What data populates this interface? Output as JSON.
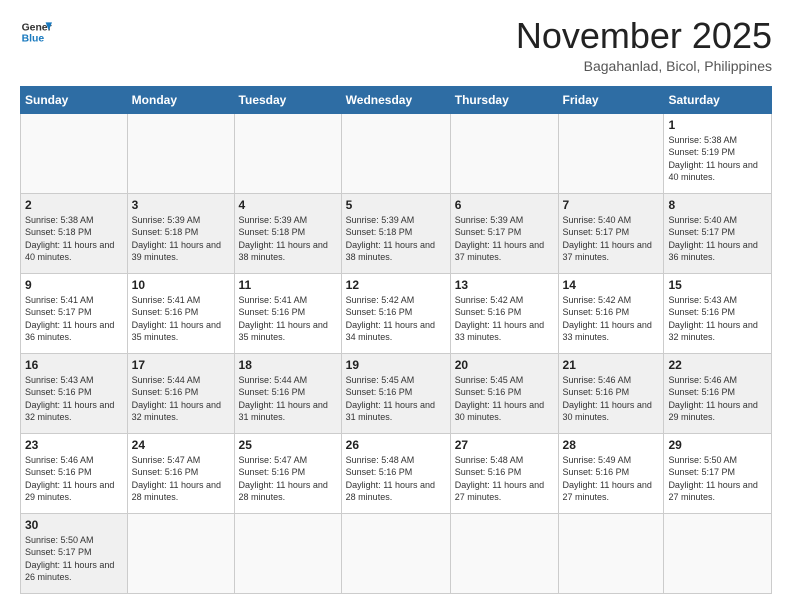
{
  "logo": {
    "line1": "General",
    "line2": "Blue"
  },
  "header": {
    "month": "November 2025",
    "location": "Bagahanlad, Bicol, Philippines"
  },
  "weekdays": [
    "Sunday",
    "Monday",
    "Tuesday",
    "Wednesday",
    "Thursday",
    "Friday",
    "Saturday"
  ],
  "weeks": [
    [
      {
        "day": "",
        "info": ""
      },
      {
        "day": "",
        "info": ""
      },
      {
        "day": "",
        "info": ""
      },
      {
        "day": "",
        "info": ""
      },
      {
        "day": "",
        "info": ""
      },
      {
        "day": "",
        "info": ""
      },
      {
        "day": "1",
        "info": "Sunrise: 5:38 AM\nSunset: 5:19 PM\nDaylight: 11 hours\nand 40 minutes."
      }
    ],
    [
      {
        "day": "2",
        "info": "Sunrise: 5:38 AM\nSunset: 5:18 PM\nDaylight: 11 hours\nand 40 minutes."
      },
      {
        "day": "3",
        "info": "Sunrise: 5:39 AM\nSunset: 5:18 PM\nDaylight: 11 hours\nand 39 minutes."
      },
      {
        "day": "4",
        "info": "Sunrise: 5:39 AM\nSunset: 5:18 PM\nDaylight: 11 hours\nand 38 minutes."
      },
      {
        "day": "5",
        "info": "Sunrise: 5:39 AM\nSunset: 5:18 PM\nDaylight: 11 hours\nand 38 minutes."
      },
      {
        "day": "6",
        "info": "Sunrise: 5:39 AM\nSunset: 5:17 PM\nDaylight: 11 hours\nand 37 minutes."
      },
      {
        "day": "7",
        "info": "Sunrise: 5:40 AM\nSunset: 5:17 PM\nDaylight: 11 hours\nand 37 minutes."
      },
      {
        "day": "8",
        "info": "Sunrise: 5:40 AM\nSunset: 5:17 PM\nDaylight: 11 hours\nand 36 minutes."
      }
    ],
    [
      {
        "day": "9",
        "info": "Sunrise: 5:41 AM\nSunset: 5:17 PM\nDaylight: 11 hours\nand 36 minutes."
      },
      {
        "day": "10",
        "info": "Sunrise: 5:41 AM\nSunset: 5:16 PM\nDaylight: 11 hours\nand 35 minutes."
      },
      {
        "day": "11",
        "info": "Sunrise: 5:41 AM\nSunset: 5:16 PM\nDaylight: 11 hours\nand 35 minutes."
      },
      {
        "day": "12",
        "info": "Sunrise: 5:42 AM\nSunset: 5:16 PM\nDaylight: 11 hours\nand 34 minutes."
      },
      {
        "day": "13",
        "info": "Sunrise: 5:42 AM\nSunset: 5:16 PM\nDaylight: 11 hours\nand 33 minutes."
      },
      {
        "day": "14",
        "info": "Sunrise: 5:42 AM\nSunset: 5:16 PM\nDaylight: 11 hours\nand 33 minutes."
      },
      {
        "day": "15",
        "info": "Sunrise: 5:43 AM\nSunset: 5:16 PM\nDaylight: 11 hours\nand 32 minutes."
      }
    ],
    [
      {
        "day": "16",
        "info": "Sunrise: 5:43 AM\nSunset: 5:16 PM\nDaylight: 11 hours\nand 32 minutes."
      },
      {
        "day": "17",
        "info": "Sunrise: 5:44 AM\nSunset: 5:16 PM\nDaylight: 11 hours\nand 32 minutes."
      },
      {
        "day": "18",
        "info": "Sunrise: 5:44 AM\nSunset: 5:16 PM\nDaylight: 11 hours\nand 31 minutes."
      },
      {
        "day": "19",
        "info": "Sunrise: 5:45 AM\nSunset: 5:16 PM\nDaylight: 11 hours\nand 31 minutes."
      },
      {
        "day": "20",
        "info": "Sunrise: 5:45 AM\nSunset: 5:16 PM\nDaylight: 11 hours\nand 30 minutes."
      },
      {
        "day": "21",
        "info": "Sunrise: 5:46 AM\nSunset: 5:16 PM\nDaylight: 11 hours\nand 30 minutes."
      },
      {
        "day": "22",
        "info": "Sunrise: 5:46 AM\nSunset: 5:16 PM\nDaylight: 11 hours\nand 29 minutes."
      }
    ],
    [
      {
        "day": "23",
        "info": "Sunrise: 5:46 AM\nSunset: 5:16 PM\nDaylight: 11 hours\nand 29 minutes."
      },
      {
        "day": "24",
        "info": "Sunrise: 5:47 AM\nSunset: 5:16 PM\nDaylight: 11 hours\nand 28 minutes."
      },
      {
        "day": "25",
        "info": "Sunrise: 5:47 AM\nSunset: 5:16 PM\nDaylight: 11 hours\nand 28 minutes."
      },
      {
        "day": "26",
        "info": "Sunrise: 5:48 AM\nSunset: 5:16 PM\nDaylight: 11 hours\nand 28 minutes."
      },
      {
        "day": "27",
        "info": "Sunrise: 5:48 AM\nSunset: 5:16 PM\nDaylight: 11 hours\nand 27 minutes."
      },
      {
        "day": "28",
        "info": "Sunrise: 5:49 AM\nSunset: 5:16 PM\nDaylight: 11 hours\nand 27 minutes."
      },
      {
        "day": "29",
        "info": "Sunrise: 5:50 AM\nSunset: 5:17 PM\nDaylight: 11 hours\nand 27 minutes."
      }
    ],
    [
      {
        "day": "30",
        "info": "Sunrise: 5:50 AM\nSunset: 5:17 PM\nDaylight: 11 hours\nand 26 minutes."
      },
      {
        "day": "",
        "info": ""
      },
      {
        "day": "",
        "info": ""
      },
      {
        "day": "",
        "info": ""
      },
      {
        "day": "",
        "info": ""
      },
      {
        "day": "",
        "info": ""
      },
      {
        "day": "",
        "info": ""
      }
    ]
  ]
}
